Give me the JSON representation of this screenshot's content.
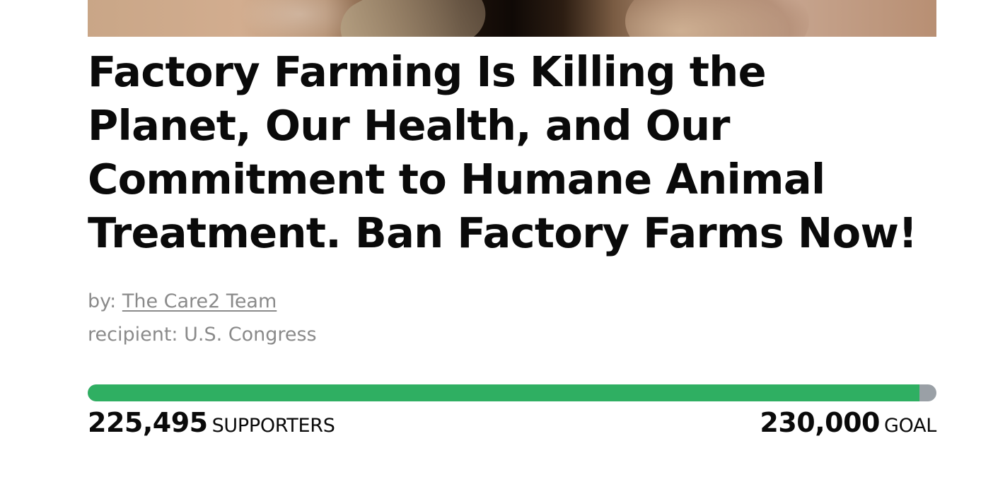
{
  "petition": {
    "title": "Factory Farming Is Killing the Planet, Our Health, and Our Commitment to Humane Animal Treatment. Ban Factory Farms Now!",
    "by_prefix": "by:",
    "author": "The Care2 Team",
    "recipient_text": "recipient: U.S. Congress"
  },
  "progress": {
    "supporters": "225,495",
    "supporters_label": "SUPPORTERS",
    "goal": "230,000",
    "goal_label": "GOAL",
    "fraction": 0.98,
    "fill_color": "#2faf62",
    "track_color": "#9aa0a6"
  }
}
